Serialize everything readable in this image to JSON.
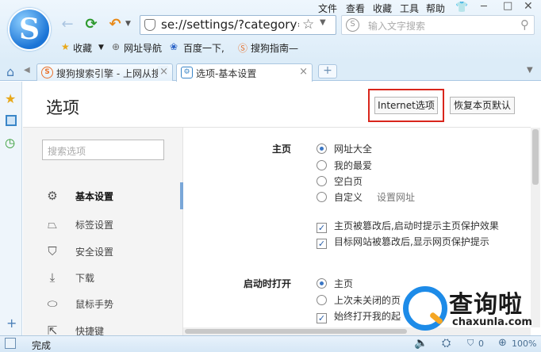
{
  "menu": [
    "文件",
    "查看",
    "收藏",
    "工具",
    "帮助"
  ],
  "address": {
    "url": "se://settings/?category=ger"
  },
  "search": {
    "placeholder": "输入文字搜索"
  },
  "bookmarks": [
    "收藏",
    "网址导航",
    "百度一下,",
    "搜狗指南—"
  ],
  "tabs": [
    {
      "title": "搜狗搜索引擎 - 上网从搜"
    },
    {
      "title": "选项-基本设置"
    }
  ],
  "page": {
    "title": "选项",
    "internet_btn": "Internet选项",
    "restore_btn": "恢复本页默认",
    "search_placeholder": "搜索选项",
    "nav": [
      "基本设置",
      "标签设置",
      "安全设置",
      "下载",
      "鼠标手势",
      "快捷键"
    ],
    "homepage": {
      "label": "主页",
      "options": [
        "网址大全",
        "我的最爱",
        "空白页",
        "自定义"
      ],
      "set_url": "设置网址",
      "checks": [
        "主页被篡改后,启动时提示主页保护效果",
        "目标网站被篡改后,显示网页保护提示"
      ]
    },
    "startup": {
      "label": "启动时打开",
      "options": [
        "主页",
        "上次未关闭的页"
      ],
      "check": "始终打开我的起"
    }
  },
  "status": {
    "text": "完成",
    "zoom": "100%",
    "badge": "0"
  },
  "watermark": {
    "text": "查询啦",
    "url": "chaxunla.com"
  },
  "colors": {
    "accent": "#3a76c4",
    "highlight_box": "#d9261c"
  }
}
